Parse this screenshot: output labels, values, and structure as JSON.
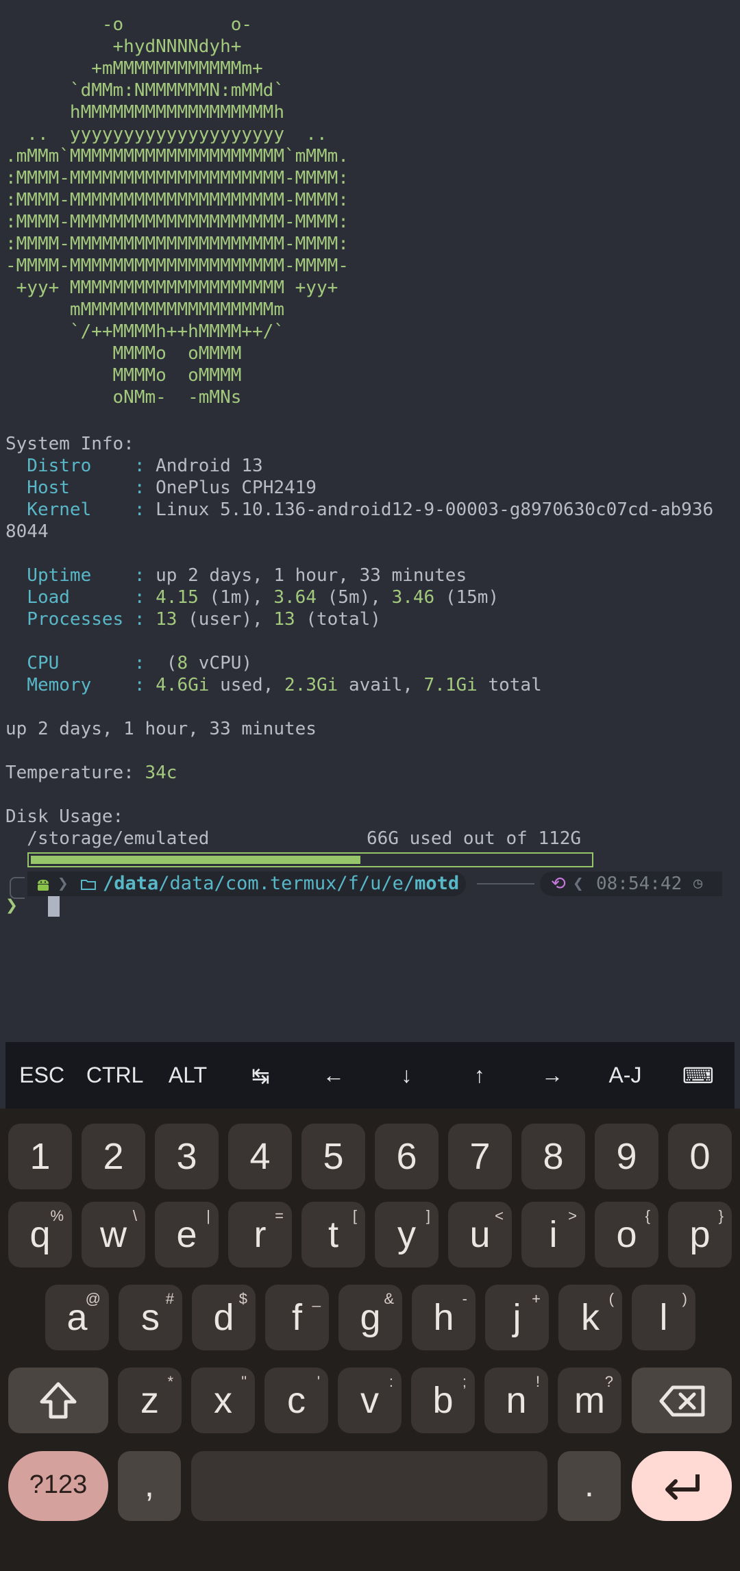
{
  "ascii_art": [
    "         -o          o-",
    "          +hydNNNNdyh+",
    "        +mMMMMMMMMMMMMm+",
    "      `dMMm:NMMMMMMN:mMMd`",
    "      hMMMMMMMMMMMMMMMMMMh",
    "  ..  yyyyyyyyyyyyyyyyyyyy  ..",
    ".mMMm`MMMMMMMMMMMMMMMMMMMM`mMMm.",
    ":MMMM-MMMMMMMMMMMMMMMMMMMM-MMMM:",
    ":MMMM-MMMMMMMMMMMMMMMMMMMM-MMMM:",
    ":MMMM-MMMMMMMMMMMMMMMMMMMM-MMMM:",
    ":MMMM-MMMMMMMMMMMMMMMMMMMM-MMMM:",
    "-MMMM-MMMMMMMMMMMMMMMMMMMM-MMMM-",
    " +yy+ MMMMMMMMMMMMMMMMMMMM +yy+",
    "      mMMMMMMMMMMMMMMMMMMm",
    "      `/++MMMMh++hMMMM++/`",
    "          MMMMo  oMMMM",
    "          MMMMo  oMMMM",
    "          oNMm-  -mMNs"
  ],
  "sysinfo": {
    "header": "System Info:",
    "distro_label": "  Distro    ",
    "distro_value": "Android 13",
    "host_label": "  Host      ",
    "host_value": "OnePlus CPH2419",
    "kernel_label": "  Kernel    ",
    "kernel_value": "Linux 5.10.136-android12-9-00003-g8970630c07cd-ab936",
    "kernel_wrap": "8044",
    "uptime_label": "  Uptime    ",
    "uptime_value": "up 2 days, 1 hour, 33 minutes",
    "load_label": "  Load      ",
    "load_1": "4.15",
    "load_1_unit": " (1m), ",
    "load_5": "3.64",
    "load_5_unit": " (5m), ",
    "load_15": "3.46",
    "load_15_unit": " (15m)",
    "proc_label": "  Processes ",
    "proc_user": "13",
    "proc_user_unit": " (user), ",
    "proc_total": "13",
    "proc_total_unit": " (total)",
    "cpu_label": "  CPU       ",
    "cpu_pre": " (",
    "cpu_count": "8",
    "cpu_post": " vCPU)",
    "mem_label": "  Memory    ",
    "mem_used": "4.6Gi",
    "mem_used_unit": " used, ",
    "mem_avail": "2.3Gi",
    "mem_avail_unit": " avail, ",
    "mem_total": "7.1Gi",
    "mem_total_unit": " total",
    "colon": ": "
  },
  "uptime_line": "up 2 days, 1 hour, 33 minutes",
  "temperature_label": "Temperature: ",
  "temperature_value": "34c",
  "disk": {
    "header": "Disk Usage:",
    "mount": "  /storage/emulated",
    "usage_text": "66G used out of 112G",
    "used_fraction": 0.589
  },
  "prompt": {
    "path_dir1": "/data",
    "path_mid": "/data/com.termux/f/u/e/",
    "path_last": "motd",
    "time": "08:54:42",
    "caret": "❯"
  },
  "extra_keys": [
    "ESC",
    "CTRL",
    "ALT",
    "↹",
    "←",
    "↓",
    "↑",
    "→",
    "A-J",
    "⌨"
  ],
  "keyboard": {
    "row_numbers": [
      "1",
      "2",
      "3",
      "4",
      "5",
      "6",
      "7",
      "8",
      "9",
      "0"
    ],
    "row1": [
      [
        "q",
        "%"
      ],
      [
        "w",
        "\\"
      ],
      [
        "e",
        "|"
      ],
      [
        "r",
        "="
      ],
      [
        "t",
        "["
      ],
      [
        "y",
        "]"
      ],
      [
        "u",
        "<"
      ],
      [
        "i",
        ">"
      ],
      [
        "o",
        "{"
      ],
      [
        "p",
        "}"
      ]
    ],
    "row2": [
      [
        "a",
        "@"
      ],
      [
        "s",
        "#"
      ],
      [
        "d",
        "$"
      ],
      [
        "f",
        "_"
      ],
      [
        "g",
        "&"
      ],
      [
        "h",
        "-"
      ],
      [
        "j",
        "+"
      ],
      [
        "k",
        "("
      ],
      [
        "l",
        ")"
      ]
    ],
    "row3": [
      [
        "z",
        "*"
      ],
      [
        "x",
        "\""
      ],
      [
        "c",
        "'"
      ],
      [
        "v",
        ":"
      ],
      [
        "b",
        ";"
      ],
      [
        "n",
        "!"
      ],
      [
        "m",
        "?"
      ]
    ],
    "symbols_key": "?123",
    "comma_key": ",",
    "period_key": ".",
    "shift_icon": "⇧",
    "backspace_icon": "⌫",
    "enter_icon": "↵"
  },
  "colors": {
    "terminal_bg": "#2b2e37",
    "green": "#a3c97d",
    "cyan": "#58b8c8",
    "keyboard_bg": "#231f1d",
    "key_bg": "#3a3532",
    "symbols_key_bg": "#d4a19c",
    "enter_key_bg": "#ffd9d4"
  }
}
